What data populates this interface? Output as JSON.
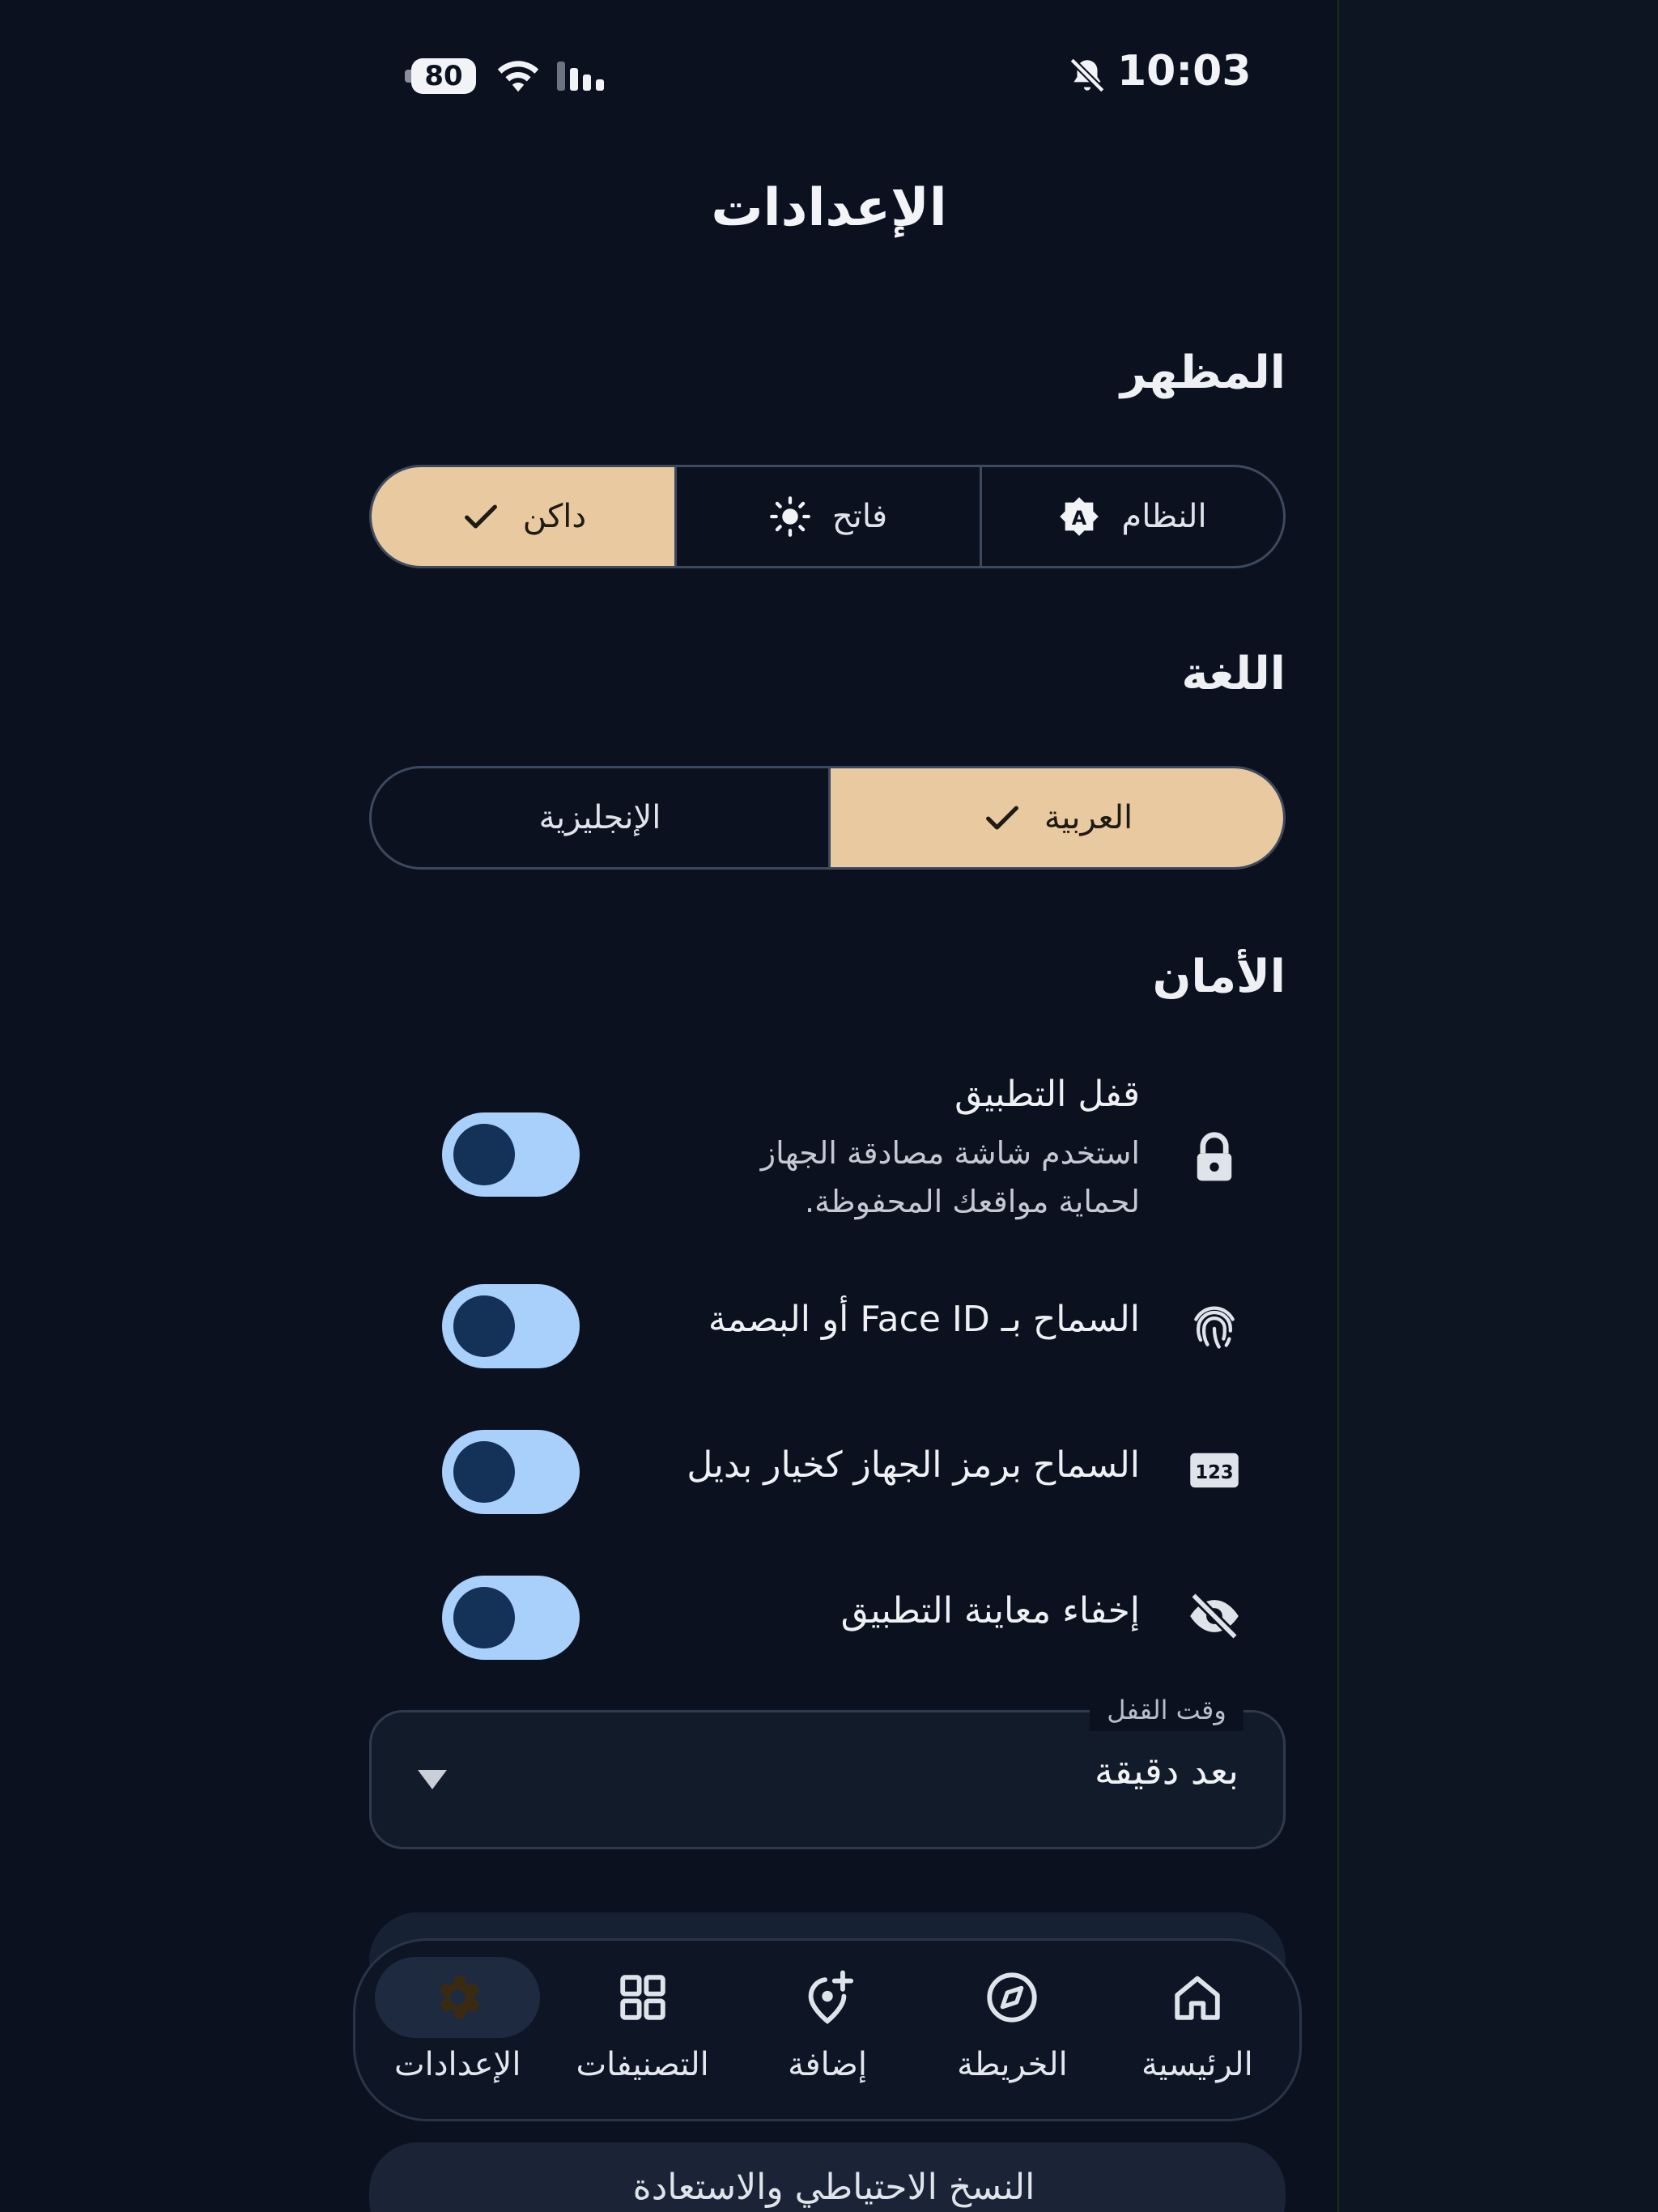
{
  "status_bar": {
    "time": "10:03",
    "battery": "80"
  },
  "page_title": "الإعدادات",
  "appearance": {
    "title": "المظهر",
    "options": [
      {
        "label": "داكن",
        "icon": "check-icon",
        "selected": true
      },
      {
        "label": "فاتح",
        "icon": "sun-icon",
        "selected": false
      },
      {
        "label": "النظام",
        "icon": "auto-brightness-icon",
        "selected": false
      }
    ]
  },
  "language": {
    "title": "اللغة",
    "options": [
      {
        "label": "الإنجليزية",
        "selected": false
      },
      {
        "label": "العربية",
        "selected": true
      }
    ]
  },
  "security": {
    "title": "الأمان",
    "rows": [
      {
        "title": "قفل التطبيق",
        "subtitle_line1": "استخدم شاشة مصادقة الجهاز",
        "subtitle_line2": "لحماية مواقعك المحفوظة.",
        "icon": "lock-icon",
        "enabled": true
      },
      {
        "title": "السماح بـ Face ID أو البصمة",
        "icon": "fingerprint-icon",
        "enabled": true
      },
      {
        "title": "السماح برمز الجهاز كخيار بديل",
        "icon": "passcode-123-icon",
        "enabled": true
      },
      {
        "title": "إخفاء معاينة التطبيق",
        "icon": "eye-off-icon",
        "enabled": true
      }
    ],
    "lock_time": {
      "label": "وقت القفل",
      "value": "بعد دقيقة"
    }
  },
  "backup_card": {
    "label": "النسخ الاحتياطي والاستعادة"
  },
  "nav": {
    "items": [
      {
        "label": "الإعدادات",
        "icon": "settings-icon",
        "active": true
      },
      {
        "label": "التصنيفات",
        "icon": "grid-icon",
        "active": false
      },
      {
        "label": "إضافة",
        "icon": "add-location-icon",
        "active": false
      },
      {
        "label": "الخريطة",
        "icon": "compass-icon",
        "active": false
      },
      {
        "label": "الرئيسية",
        "icon": "home-icon",
        "active": false
      }
    ]
  },
  "colors": {
    "background": "#0b111f",
    "accent": "#e8c9a0",
    "toggle_track": "#a9cffb",
    "toggle_knob": "#143157",
    "active_nav_icon": "#3a2a12"
  }
}
